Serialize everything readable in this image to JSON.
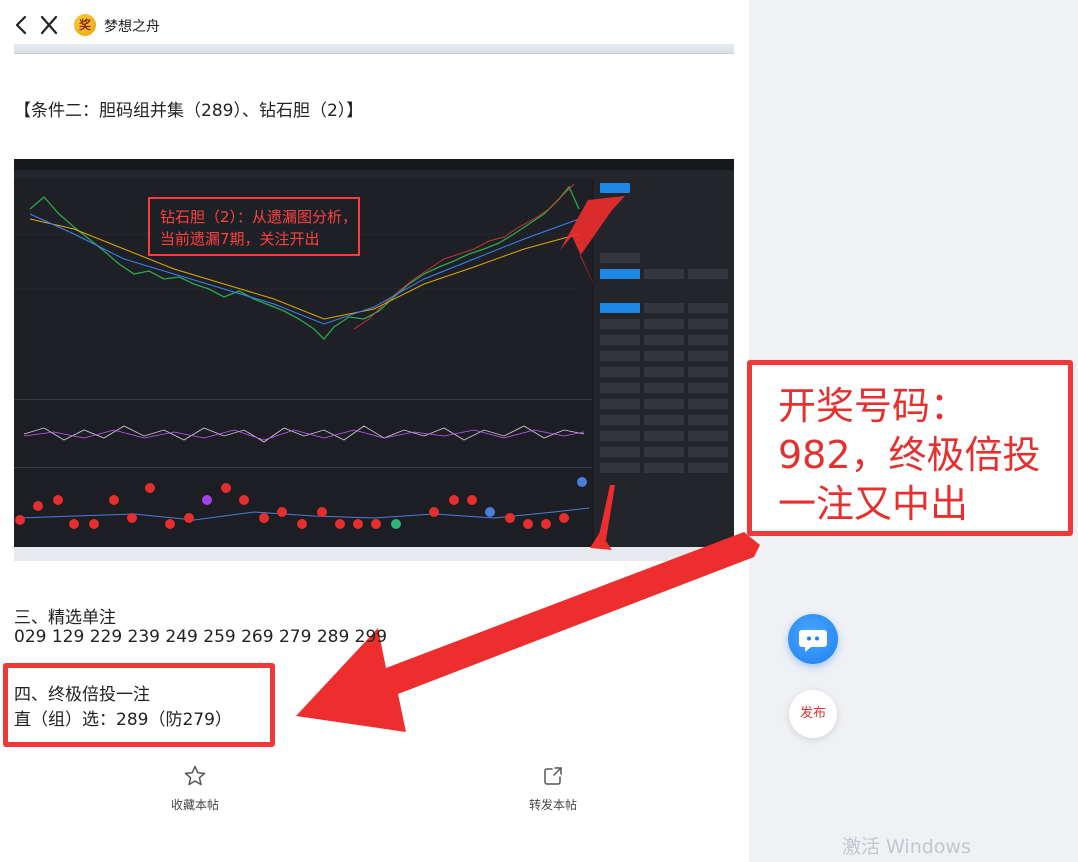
{
  "header": {
    "site_name": "梦想之舟",
    "avatar_glyph": "奖"
  },
  "post": {
    "condition_line": "【条件二：胆码组并集（289）、钻石胆（2）】",
    "section3_title": "三、精选单注",
    "section3_numbers": "029 129 229 239 249 259 269 279 289 299",
    "section4_title": "四、终极倍投一注",
    "section4_value": "直（组）选：289（防279）"
  },
  "screenshot": {
    "annotation": "钻石胆（2）：从遗漏图分析，\n当前遗漏7期，关注开出"
  },
  "callout": {
    "text": "开奖号码：982，终极倍投一注又中出"
  },
  "actions": {
    "favorite_label": "收藏本帖",
    "share_label": "转发本帖"
  },
  "floating": {
    "publish_label": "发布"
  },
  "watermark": "激活 Windows",
  "colors": {
    "annotation_red": "#f03838",
    "accent_blue": "#1d7ff0",
    "right_pane_bg": "#eff1f4"
  },
  "icons": [
    "back-icon",
    "close-icon",
    "star-icon",
    "share-icon",
    "chat-icon"
  ]
}
